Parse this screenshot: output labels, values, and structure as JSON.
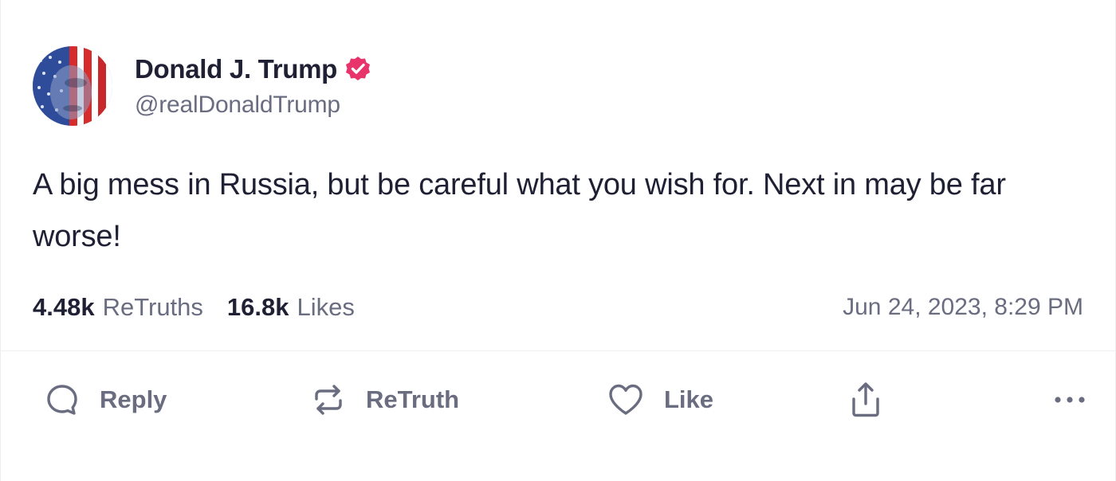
{
  "author": {
    "display_name": "Donald J. Trump",
    "handle": "@realDonaldTrump",
    "verified": true,
    "verified_color": "#e9346b"
  },
  "post": {
    "text": "A big mess in Russia, but be careful what you wish for. Next in may be far worse!",
    "timestamp": "Jun 24, 2023, 8:29 PM"
  },
  "stats": {
    "retruths_count": "4.48k",
    "retruths_label": "ReTruths",
    "likes_count": "16.8k",
    "likes_label": "Likes"
  },
  "actions": {
    "reply_label": "Reply",
    "retruth_label": "ReTruth",
    "like_label": "Like"
  },
  "icons": {
    "reply": "speech-bubble-icon",
    "retruth": "repost-arrows-icon",
    "like": "heart-icon",
    "share": "share-upload-icon",
    "more": "ellipsis-icon",
    "verified": "verified-badge-icon"
  },
  "colors": {
    "text_primary": "#1f2033",
    "text_secondary": "#6a6c80"
  }
}
